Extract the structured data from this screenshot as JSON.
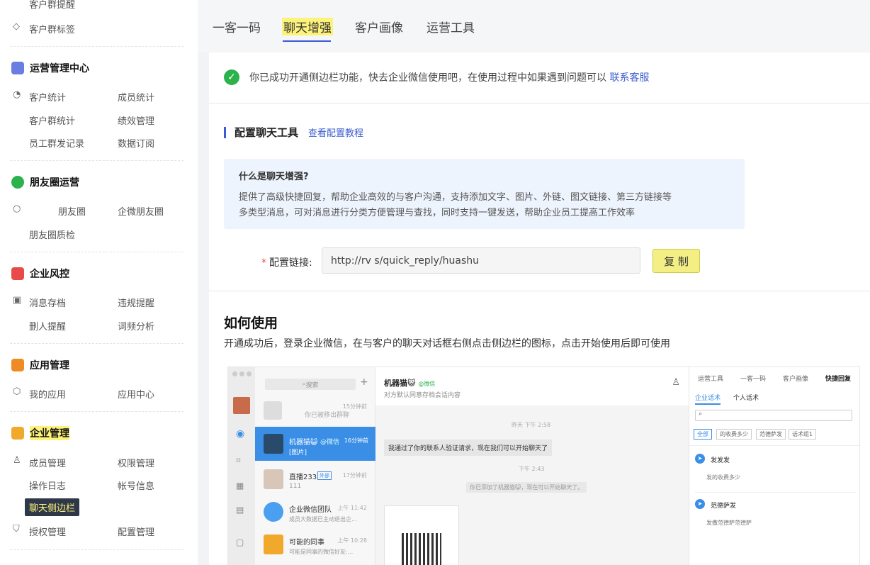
{
  "sidebar": {
    "top_items": [
      "客户群提醒",
      "客户群标签"
    ],
    "sections": [
      {
        "title": "运营管理中心",
        "items": [
          "客户统计",
          "成员统计",
          "客户群统计",
          "绩效管理",
          "员工群发记录",
          "数据订阅"
        ]
      },
      {
        "title": "朋友圈运营",
        "items": [
          "朋友圈",
          "企微朋友圈",
          "朋友圈质检"
        ]
      },
      {
        "title": "企业风控",
        "items": [
          "消息存档",
          "违规提醒",
          "删人提醒",
          "词频分析"
        ]
      },
      {
        "title": "应用管理",
        "items": [
          "我的应用",
          "应用中心"
        ]
      },
      {
        "title": "企业管理",
        "items": [
          "成员管理",
          "权限管理",
          "操作日志",
          "帐号信息",
          "聊天侧边栏",
          "授权管理",
          "配置管理"
        ]
      }
    ],
    "colors": {
      "accent": "#3b5bd6",
      "highlight": "#fdf37a",
      "active_bg": "#2f3848"
    }
  },
  "tabs": [
    "一客一码",
    "聊天增强",
    "客户画像",
    "运营工具"
  ],
  "notice": {
    "text": "你已成功开通侧边栏功能，快去企业微信使用吧，在使用过程中如果遇到问题可以",
    "link": "联系客服"
  },
  "config": {
    "title": "配置聊天工具",
    "tutorial_link": "查看配置教程",
    "info_title": "什么是聊天增强?",
    "info_line1": "提供了高级快捷回复，帮助企业高效的与客户沟通，支持添加文字、图片、外链、图文链接、第三方链接等",
    "info_line2": "多类型消息，可对消息进行分类方便管理与查找，同时支持一键发送，帮助企业员工提高工作效率",
    "link_label": "配置链接:",
    "link_value": "http://rv                         s/quick_reply/huashu",
    "copy_label": "复 制"
  },
  "how": {
    "title": "如何使用",
    "desc": "开通成功后，登录企业微信，在与客户的聊天对话框右侧点击侧边栏的图标，点击开始使用后即可使用"
  },
  "screenshot": {
    "search": "搜索",
    "list": [
      {
        "name": "",
        "preview": "你已被移出群聊",
        "time": "15分钟前"
      },
      {
        "name": "机器猫😺",
        "tag": "@微信",
        "preview": "[图片]",
        "time": "16分钟前"
      },
      {
        "name": "直播233",
        "tag": "外部",
        "preview": "111",
        "time": "17分钟前"
      },
      {
        "name": "企业微信团队",
        "preview": "成员大数据已主动退出企...",
        "time": "上午 11:42"
      },
      {
        "name": "可能的同事",
        "preview": "可能是同事的微信好友:...",
        "time": "上午 10:28"
      }
    ],
    "chat_name": "机器猫😺",
    "chat_tag": "@微信",
    "chat_sub": "对方默认同意存档会话内容",
    "time1": "昨天 下午 2:58",
    "msg1": "我通过了你的联系人验证请求，现在我们可以开始聊天了",
    "time2": "下午 2:43",
    "sys_msg": "你已添加了机器猫😺，现在可以开始聊天了。",
    "panel_tabs": [
      "运营工具",
      "一客一码",
      "客户画像",
      "快捷回复"
    ],
    "panel_subtabs": [
      "企业话术",
      "个人话术"
    ],
    "filters": [
      "全部",
      "的收费多少",
      "范德萨发",
      "话术组1"
    ],
    "replies": [
      {
        "title": "发发发",
        "sub": "发的收费多少"
      },
      {
        "title": "范德萨发",
        "sub": "发撒范德萨范德萨"
      }
    ]
  }
}
